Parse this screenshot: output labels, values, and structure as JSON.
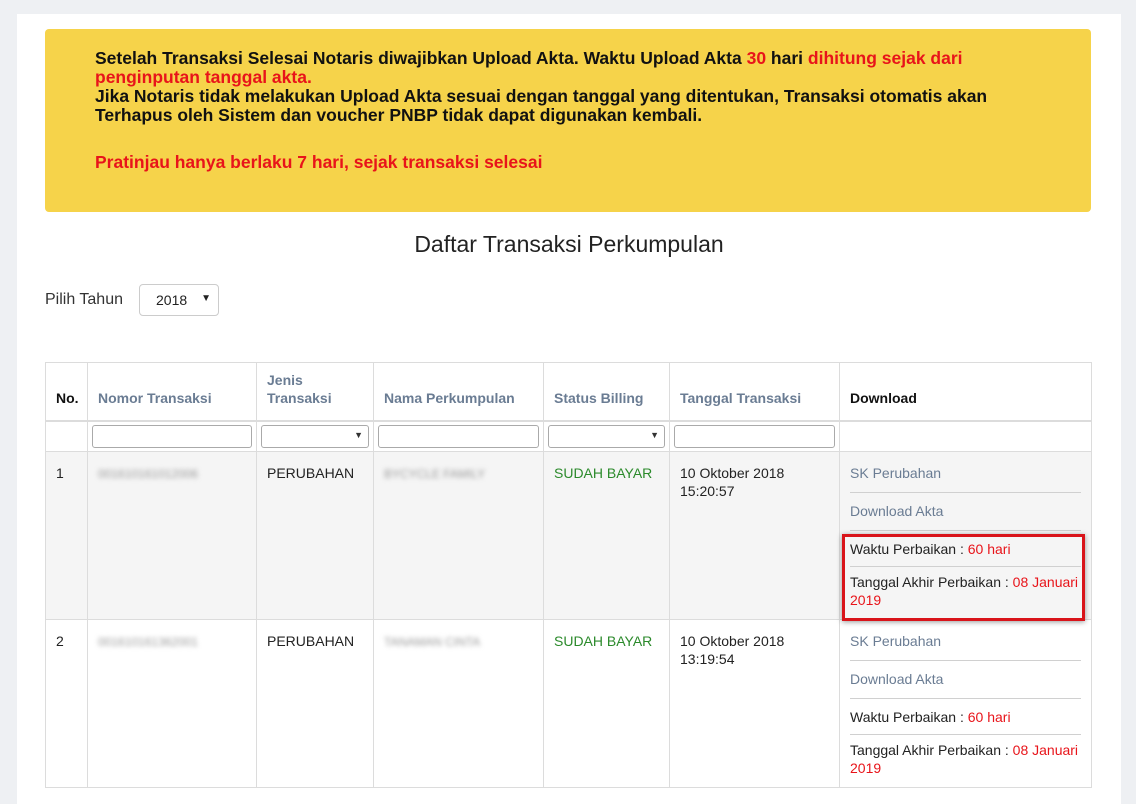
{
  "notice": {
    "line1_a": "Setelah Transaksi Selesai Notaris diwajibkan Upload Akta. Waktu Upload Akta ",
    "line1_days": "30",
    "line1_b": " hari ",
    "line1_c": "dihitung sejak dari penginputan tanggal akta.",
    "line2": "Jika Notaris tidak melakukan Upload Akta sesuai dengan tanggal yang ditentukan, Transaksi otomatis akan Terhapus oleh Sistem dan voucher PNBP tidak dapat digunakan kembali.",
    "line3": "Pratinjau hanya berlaku 7 hari, sejak transaksi selesai"
  },
  "page_title": "Daftar Transaksi Perkumpulan",
  "year_filter": {
    "label": "Pilih Tahun",
    "value": "2018"
  },
  "table": {
    "headers": [
      "No.",
      "Nomor Transaksi",
      "Jenis Transaksi",
      "Nama Perkumpulan",
      "Status Billing",
      "Tanggal Transaksi",
      "Download"
    ],
    "rows": [
      {
        "no": "1",
        "nomor": "001610161012006",
        "jenis": "PERUBAHAN",
        "nama": "BYCYCLE FAMILY",
        "status": "SUDAH BAYAR",
        "tanggal": "10 Oktober 2018",
        "jam": "15:20:57",
        "link1": "SK Perubahan",
        "link2": "Download Akta",
        "waktu_label": "Waktu Perbaikan : ",
        "waktu_value": "60 hari",
        "akhir_label": "Tanggal Akhir Perbaikan : ",
        "akhir_value": "08 Januari 2019"
      },
      {
        "no": "2",
        "nomor": "001610161362001",
        "jenis": "PERUBAHAN",
        "nama": "TANAMAN CINTA",
        "status": "SUDAH BAYAR",
        "tanggal": "10 Oktober 2018",
        "jam": "13:19:54",
        "link1": "SK Perubahan",
        "link2": "Download Akta",
        "waktu_label": "Waktu Perbaikan : ",
        "waktu_value": "60 hari",
        "akhir_label": "Tanggal Akhir Perbaikan : ",
        "akhir_value": "08 Januari 2019"
      }
    ]
  },
  "colors": {
    "notice_bg": "#f6d34a",
    "accent_red": "#e8141a",
    "status_green": "#2b8a2b",
    "header_link": "#6a7c93"
  }
}
